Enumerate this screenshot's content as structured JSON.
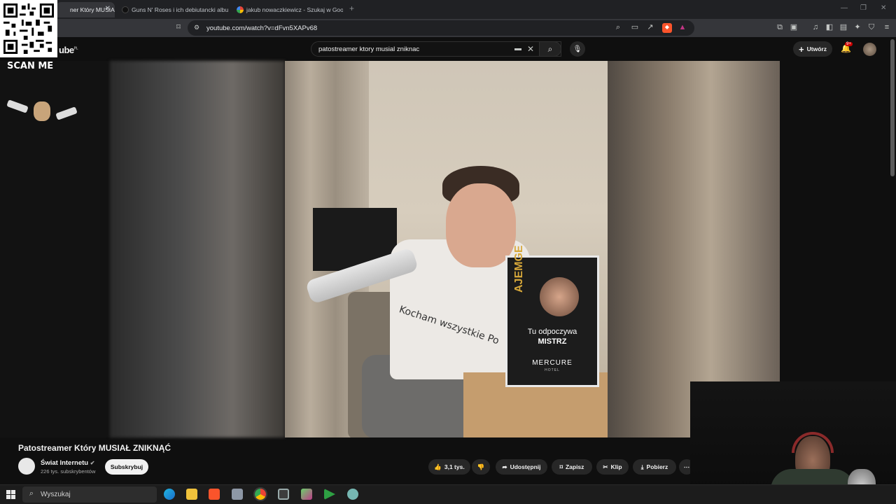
{
  "browser": {
    "tabs": [
      {
        "label": "ner Który MUSIA"
      },
      {
        "label": "Guns N' Roses i ich debiutancki albu"
      },
      {
        "label": "jakub nowaczkiewicz - Szukaj w Goo"
      }
    ],
    "new_tab": "+",
    "url": "youtube.com/watch?v=dFvn5XAPv68"
  },
  "youtube": {
    "logo_partial": "ube",
    "logo_region": "PL",
    "search_value": "patostreamer ktory musial zniknac",
    "create_label": "Utwórz",
    "notification_count": "9+"
  },
  "overlay": {
    "scan_me": "SCAN ME"
  },
  "video": {
    "shirt_text": "Kocham wszystkie Po",
    "sign_vertical": "AJEMGE",
    "sign_line1": "Tu odpoczywa",
    "sign_line2": "MISTRZ",
    "sign_brand": "MERCURE",
    "sign_brand_sub": "HOTEL"
  },
  "below_video": {
    "title": "Patostreamer Który MUSIAŁ ZNIKNĄĆ",
    "channel": "Świat Internetu",
    "subscribers": "226 tys. subskrybentów",
    "subscribe_label": "Subskrybuj",
    "likes": "3,1 tys.",
    "share_label": "Udostępnij",
    "save_label": "Zapisz",
    "clip_label": "Klip",
    "download_label": "Pobierz",
    "more_label": "⋯"
  },
  "taskbar": {
    "search_placeholder": "Wyszukaj"
  }
}
